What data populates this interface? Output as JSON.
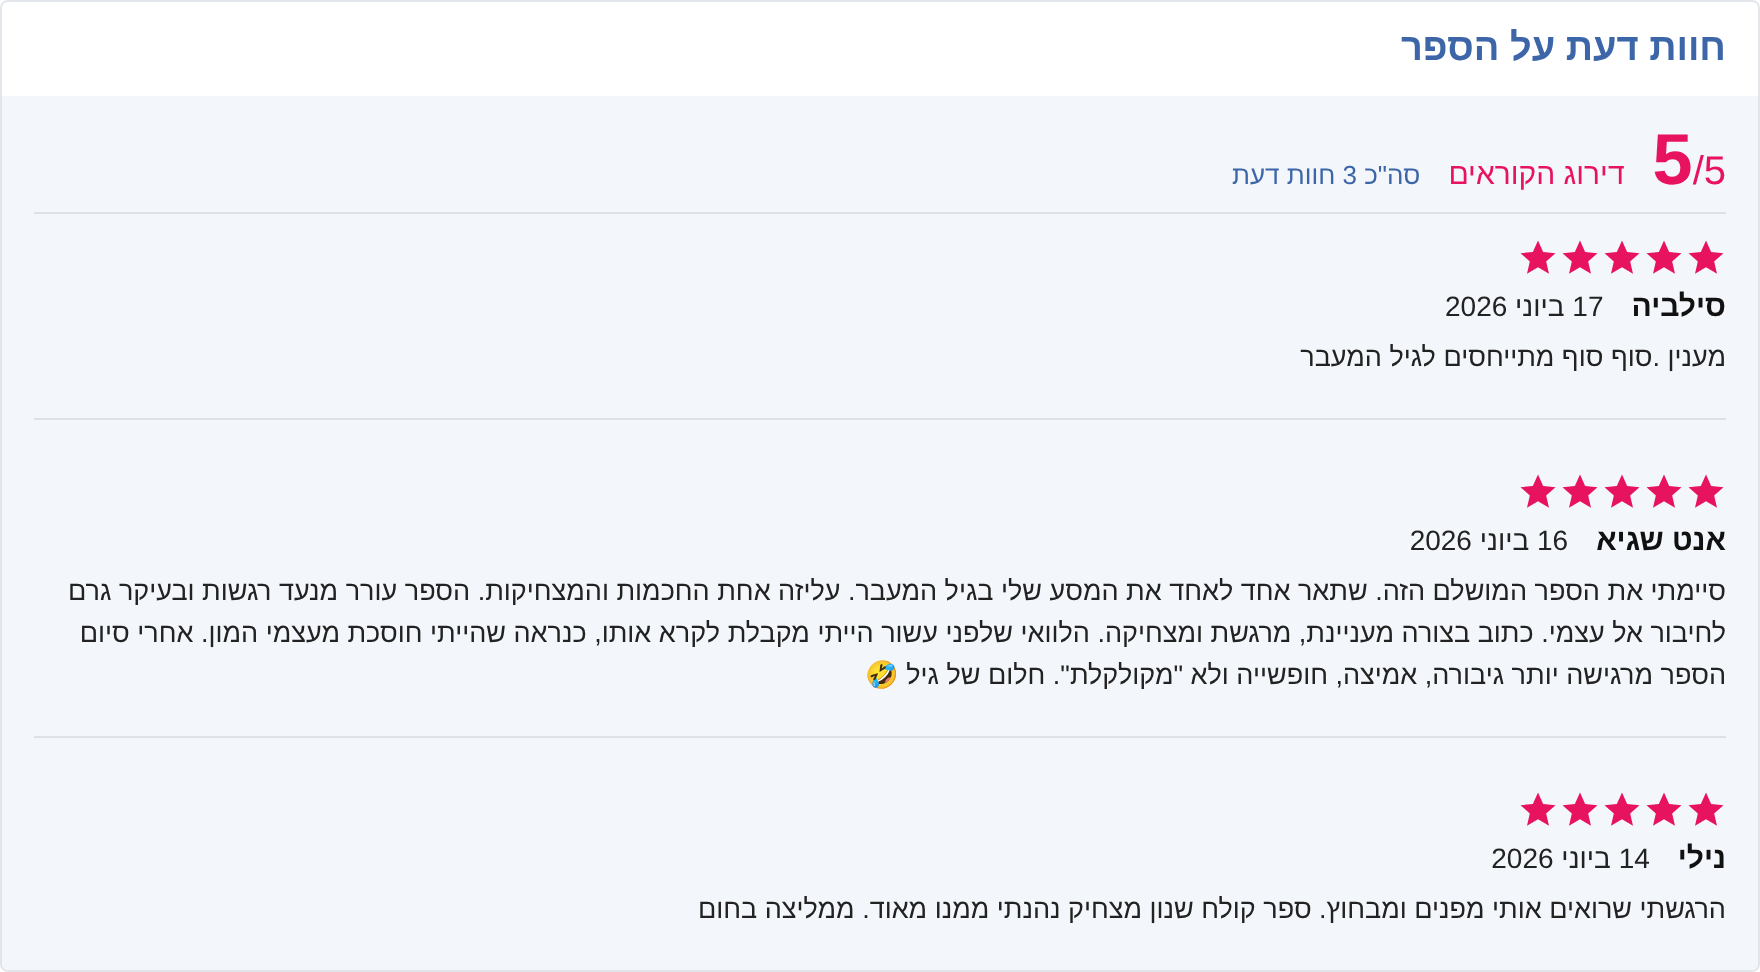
{
  "title": "חוות דעת על הספר",
  "summary": {
    "score": "5",
    "out_of": "/5",
    "label": "דירוג הקוראים",
    "total": "סה\"כ 3 חוות דעת"
  },
  "reviews": [
    {
      "stars": 5,
      "name": "סילביה",
      "date": "17 ביוני 2026",
      "text": "מענין .סוף סוף מתייחסים לגיל המעבר"
    },
    {
      "stars": 5,
      "name": "אנט שגיא",
      "date": "16 ביוני 2026",
      "text": "סיימתי את הספר המושלם הזה. שתאר אחד לאחד את המסע שלי בגיל המעבר. עליזה אחת החכמות והמצחיקות. הספר עורר מנעד רגשות ובעיקר גרם לחיבור אל עצמי. כתוב בצורה מעניינת, מרגשת ומצחיקה. הלוואי שלפני עשור הייתי מקבלת לקרא אותו, כנראה שהייתי חוסכת מעצמי המון. אחרי סיום הספר מרגישה יותר גיבורה, אמיצה, חופשייה ולא \"מקולקלת\". חלום של גיל 🤣"
    },
    {
      "stars": 5,
      "name": "נילי",
      "date": "14 ביוני 2026",
      "text": "הרגשתי שרואים אותי מפנים ומבחוץ. ספר קולח שנון מצחיק נהנתי ממנו מאוד. ממליצה בחום"
    }
  ]
}
